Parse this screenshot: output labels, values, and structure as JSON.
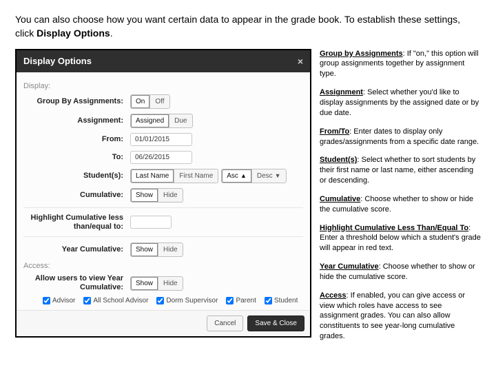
{
  "intro": {
    "text_before": "You can also choose how you want certain data to appear in the grade book. To establish these settings, click ",
    "bold": "Display Options",
    "text_after": "."
  },
  "modal": {
    "title": "Display Options",
    "sections": {
      "display": "Display:",
      "access": "Access:"
    },
    "rows": {
      "group_by": {
        "label": "Group By Assignments:",
        "on": "On",
        "off": "Off"
      },
      "assignment": {
        "label": "Assignment:",
        "assigned": "Assigned",
        "due": "Due"
      },
      "from": {
        "label": "From:",
        "value": "01/01/2015"
      },
      "to": {
        "label": "To:",
        "value": "06/26/2015"
      },
      "students": {
        "label": "Student(s):",
        "last": "Last Name",
        "first": "First Name",
        "asc": "Asc",
        "desc": "Desc"
      },
      "cumulative": {
        "label": "Cumulative:",
        "show": "Show",
        "hide": "Hide"
      },
      "highlight": {
        "label": "Highlight Cumulative less than/equal to:",
        "value": ""
      },
      "year": {
        "label": "Year Cumulative:",
        "show": "Show",
        "hide": "Hide"
      },
      "allow": {
        "label": "Allow users to view Year Cumulative:",
        "show": "Show",
        "hide": "Hide"
      }
    },
    "checkboxes": {
      "advisor": "Advisor",
      "all_school": "All School Advisor",
      "dorm": "Dorm Supervisor",
      "parent": "Parent",
      "student": "Student"
    },
    "footer": {
      "cancel": "Cancel",
      "save": "Save & Close"
    }
  },
  "side": {
    "group": {
      "t": "Group by Assignments",
      "d": ": If \"on,\" this option will group assignments together by assignment type."
    },
    "assignment": {
      "t": "Assignment",
      "d": ": Select whether you'd like to display assignments by the assigned date or by due date."
    },
    "fromto": {
      "t": "From/To",
      "d": ": Enter dates to display only grades/assignments from a specific date range."
    },
    "students": {
      "t": "Student(s)",
      "d": ": Select whether to sort students by their first name or last name, either ascending or descending."
    },
    "cumulative": {
      "t": "Cumulative",
      "d": ": Choose whether to show or hide the cumulative score."
    },
    "highlight": {
      "t": "Highlight Cumulative Less Than/Equal To",
      "d": ": Enter a threshold below which a student's grade will appear in red text."
    },
    "year": {
      "t": "Year Cumulative",
      "d": ": Choose whether to show or hide the cumulative score."
    },
    "access": {
      "t": "Access",
      "d": ": If enabled, you can give access or view which roles have access to see assignment grades. You can also allow constituents to see year-long cumulative grades."
    }
  }
}
